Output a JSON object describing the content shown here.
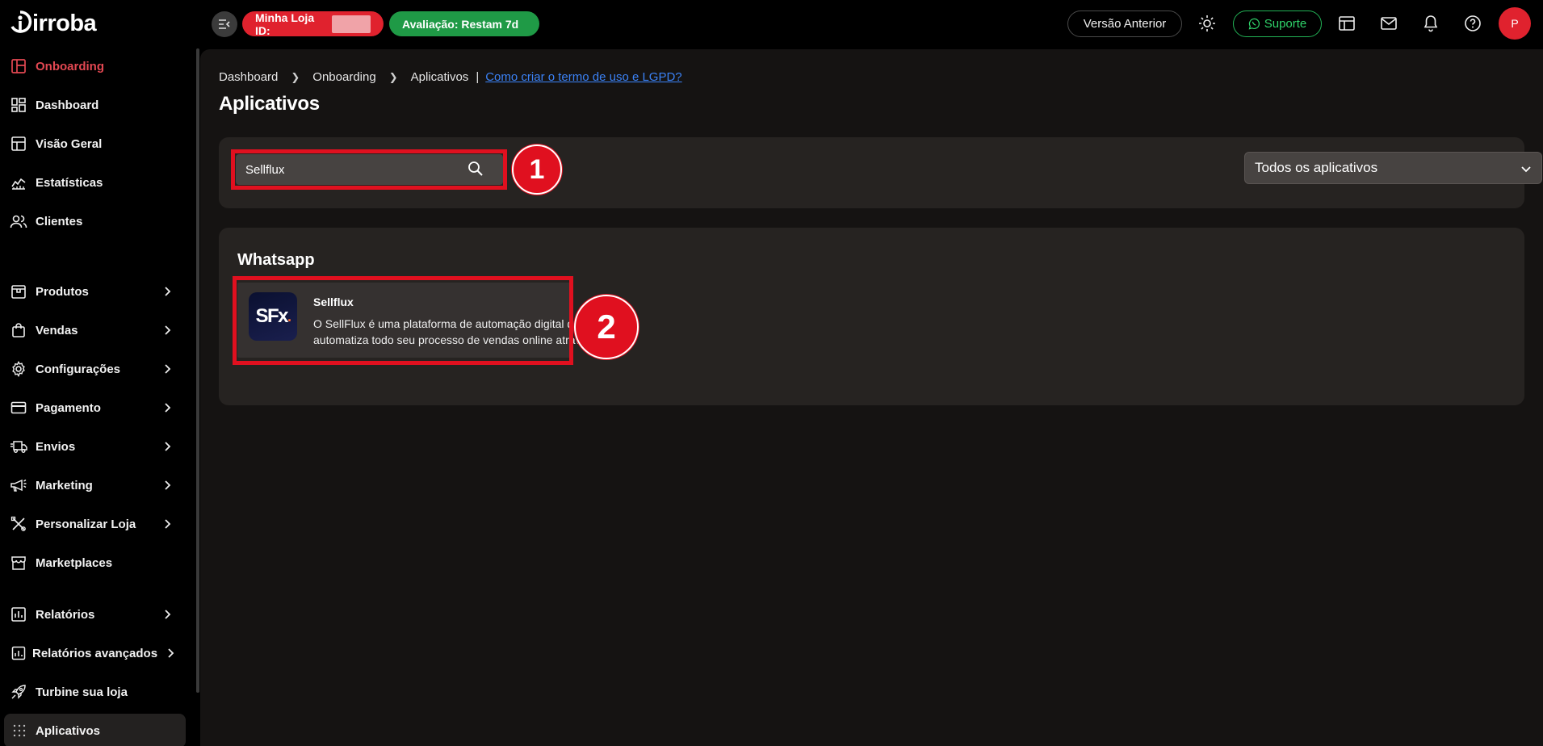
{
  "header": {
    "logo_text": "irroba",
    "store_label": "Minha Loja ID:",
    "evaluation_label": "Avaliação: Restam 7d",
    "previous_version_label": "Versão Anterior",
    "support_label": "Suporte",
    "avatar_initial": "P",
    "colors": {
      "store_pill": "#e0222e",
      "evaluation_pill": "#1f9a46",
      "support": "#2fd36a"
    }
  },
  "sidebar": {
    "items": [
      {
        "label": "Onboarding",
        "icon": "layout-icon"
      },
      {
        "label": "Dashboard",
        "icon": "dashboard-grid-icon"
      },
      {
        "label": "Visão Geral",
        "icon": "layout-panel-icon"
      },
      {
        "label": "Estatísticas",
        "icon": "line-chart-icon"
      },
      {
        "label": "Clientes",
        "icon": "users-icon"
      },
      {
        "label": "Produtos",
        "icon": "box-icon"
      },
      {
        "label": "Vendas",
        "icon": "shopping-bag-icon"
      },
      {
        "label": "Configurações",
        "icon": "gear-icon"
      },
      {
        "label": "Pagamento",
        "icon": "credit-card-icon"
      },
      {
        "label": "Envios",
        "icon": "truck-icon"
      },
      {
        "label": "Marketing",
        "icon": "megaphone-icon"
      },
      {
        "label": "Personalizar Loja",
        "icon": "tools-icon"
      },
      {
        "label": "Marketplaces",
        "icon": "store-icon"
      },
      {
        "label": "Relatórios",
        "icon": "bar-chart-icon"
      },
      {
        "label": "Relatórios avançados",
        "icon": "report-icon"
      },
      {
        "label": "Turbine sua loja",
        "icon": "rocket-icon"
      },
      {
        "label": "Aplicativos",
        "icon": "apps-dots-icon"
      }
    ]
  },
  "main": {
    "breadcrumb": [
      "Dashboard",
      "Onboarding",
      "Aplicativos"
    ],
    "help_link": "Como criar o termo de uso e LGPD?",
    "title": "Aplicativos",
    "search": {
      "value": "Sellflux"
    },
    "filter": {
      "selected": "Todos os aplicativos"
    },
    "category": "Whatsapp",
    "apps": [
      {
        "name": "Sellflux",
        "logo_text": "SFx",
        "description": "O SellFlux é uma plataforma de automação digital que automatiza todo seu processo de vendas online atravé..."
      }
    ],
    "callouts": [
      "1",
      "2"
    ]
  }
}
